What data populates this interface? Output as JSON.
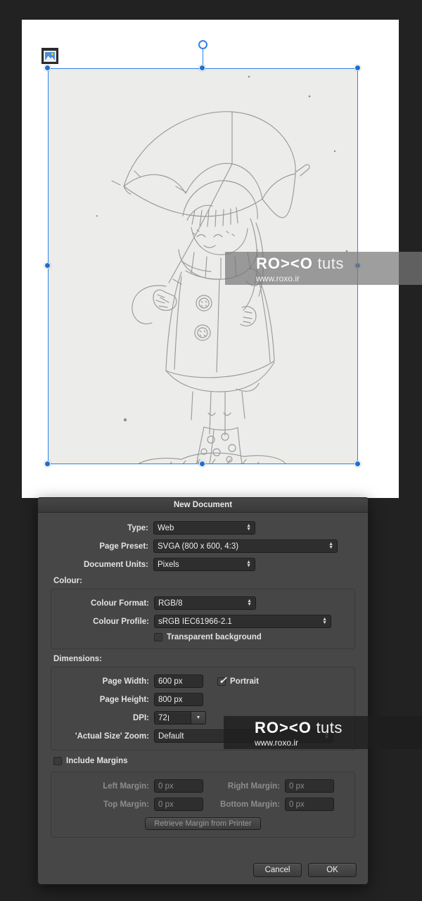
{
  "app": {
    "canvas_icon": "image-thumbnail-icon",
    "artwork_description": "Pencil sketch of a girl holding an umbrella standing in a puddle, wearing a coat and polka-dot boots"
  },
  "watermark": {
    "brand_bold": "RO><O",
    "brand_light": "tuts",
    "url": "www.roxo.ir"
  },
  "dialog": {
    "title": "New Document",
    "fields": {
      "type": {
        "label": "Type:",
        "value": "Web"
      },
      "page_preset": {
        "label": "Page Preset:",
        "value": "SVGA  (800 x 600, 4:3)"
      },
      "document_units": {
        "label": "Document Units:",
        "value": "Pixels"
      }
    },
    "colour": {
      "section_label": "Colour:",
      "colour_format": {
        "label": "Colour Format:",
        "value": "RGB/8"
      },
      "colour_profile": {
        "label": "Colour Profile:",
        "value": "sRGB IEC61966-2.1"
      },
      "transparent_background": {
        "label": "Transparent background",
        "checked": false
      }
    },
    "dimensions": {
      "section_label": "Dimensions:",
      "page_width": {
        "label": "Page Width:",
        "value": "600 px"
      },
      "page_height": {
        "label": "Page Height:",
        "value": "800 px"
      },
      "dpi": {
        "label": "DPI:",
        "value": "72"
      },
      "actual_size_zoom": {
        "label": "'Actual Size' Zoom:",
        "value": "Default"
      },
      "portrait": {
        "label": "Portrait",
        "checked": true
      }
    },
    "margins": {
      "include_margins": {
        "label": "Include Margins",
        "checked": false
      },
      "left_margin": {
        "label": "Left Margin:",
        "value": "0 px"
      },
      "right_margin": {
        "label": "Right Margin:",
        "value": "0 px"
      },
      "top_margin": {
        "label": "Top Margin:",
        "value": "0 px"
      },
      "bottom_margin": {
        "label": "Bottom Margin:",
        "value": "0 px"
      },
      "retrieve_button": "Retrieve Margin from Printer"
    },
    "buttons": {
      "cancel": "Cancel",
      "ok": "OK"
    }
  },
  "glyphs": {
    "up": "▲",
    "down": "▼",
    "check": "✓"
  },
  "colors": {
    "accent_selection": "#2f84e8",
    "dialog_bg": "#474747",
    "field_bg": "#2e2e2e",
    "app_bg": "#222222",
    "canvas_white": "#ffffff"
  }
}
